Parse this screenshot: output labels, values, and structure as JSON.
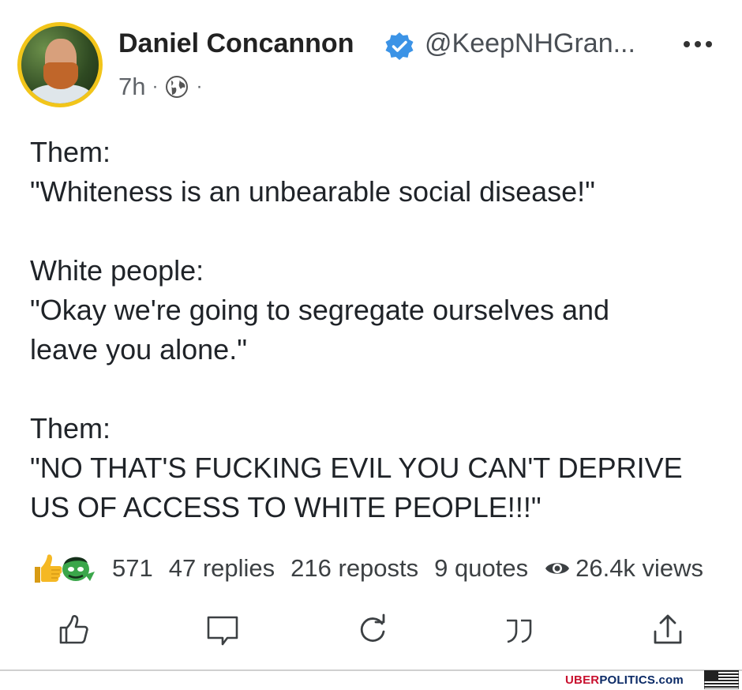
{
  "post": {
    "author": {
      "name": "Daniel Concannon",
      "handle": "@KeepNHGran...",
      "verified": true,
      "avatar_ring_color": "#f2c51a"
    },
    "meta": {
      "timestamp": "7h",
      "separator": "·",
      "visibility_icon": "globe-icon"
    },
    "body": [
      {
        "lines": [
          "Them:",
          "\"Whiteness is an unbearable social disease!\""
        ]
      },
      {
        "lines": [
          "White people:",
          "\"Okay we're going to segregate ourselves and",
          "leave you alone.\""
        ]
      },
      {
        "lines": [
          "Them:",
          "\"NO THAT'S FUCKING EVIL YOU CAN'T DEPRIVE",
          "US OF ACCESS TO WHITE PEOPLE!!!\""
        ]
      }
    ],
    "stats": {
      "reactions": "571",
      "replies": "47 replies",
      "reposts": "216 reposts",
      "quotes": "9 quotes",
      "views": "26.4k views"
    },
    "actions": [
      "like-icon",
      "reply-icon",
      "repost-icon",
      "quote-icon",
      "share-icon"
    ]
  },
  "watermark": {
    "uber": "UBER",
    "rest": "POLITICS.com"
  },
  "colors": {
    "verified": "#3b93e6",
    "watermark_red": "#c8102e",
    "watermark_blue": "#0b2a66"
  }
}
